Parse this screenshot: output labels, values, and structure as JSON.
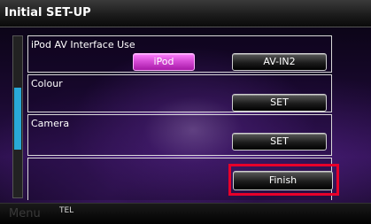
{
  "header": {
    "title": "Initial SET-UP"
  },
  "rows": [
    {
      "label": "iPod AV Interface Use",
      "options": [
        "iPod",
        "AV-IN2"
      ],
      "selected": "iPod"
    },
    {
      "label": "Colour",
      "button": "SET"
    },
    {
      "label": "Camera",
      "button": "SET"
    }
  ],
  "finish_button": "Finish",
  "footer": {
    "menu": "Menu",
    "tel": "TEL"
  },
  "colors": {
    "accent": "#d64bd6",
    "highlight": "#e8002a",
    "scroll": "#29a9d8"
  }
}
